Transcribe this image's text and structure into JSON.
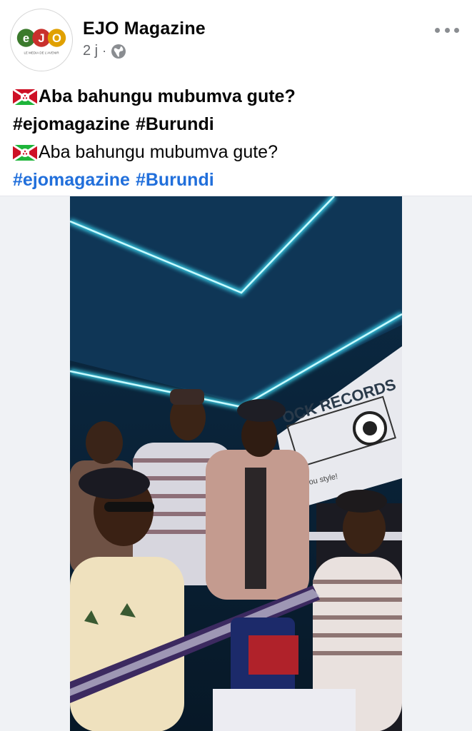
{
  "post": {
    "author": "EJO Magazine",
    "time": "2 j",
    "separator": "·",
    "privacy_icon": "globe-icon",
    "more_icon": "more-dots-icon"
  },
  "avatar": {
    "logo_letters": [
      "e",
      "J",
      "O"
    ],
    "tagline": "LE MEDIA DE L'AVENIR"
  },
  "caption": {
    "flag_icon": "burundi-flag-icon",
    "line1": "Aba bahungu mubumva gute?",
    "line1_hashtags": [
      "#ejomagazine",
      "#Burundi"
    ],
    "line2": "Aba bahungu mubumva gute?",
    "line2_hashtags": [
      "#ejomagazine",
      "#Burundi"
    ]
  },
  "video": {
    "scene_text": "OCK RECORDS",
    "scene_subtext": "you style!"
  },
  "colors": {
    "hashtag": "#216fdb",
    "meta": "#65676b",
    "neon": "#3fe6ff"
  }
}
